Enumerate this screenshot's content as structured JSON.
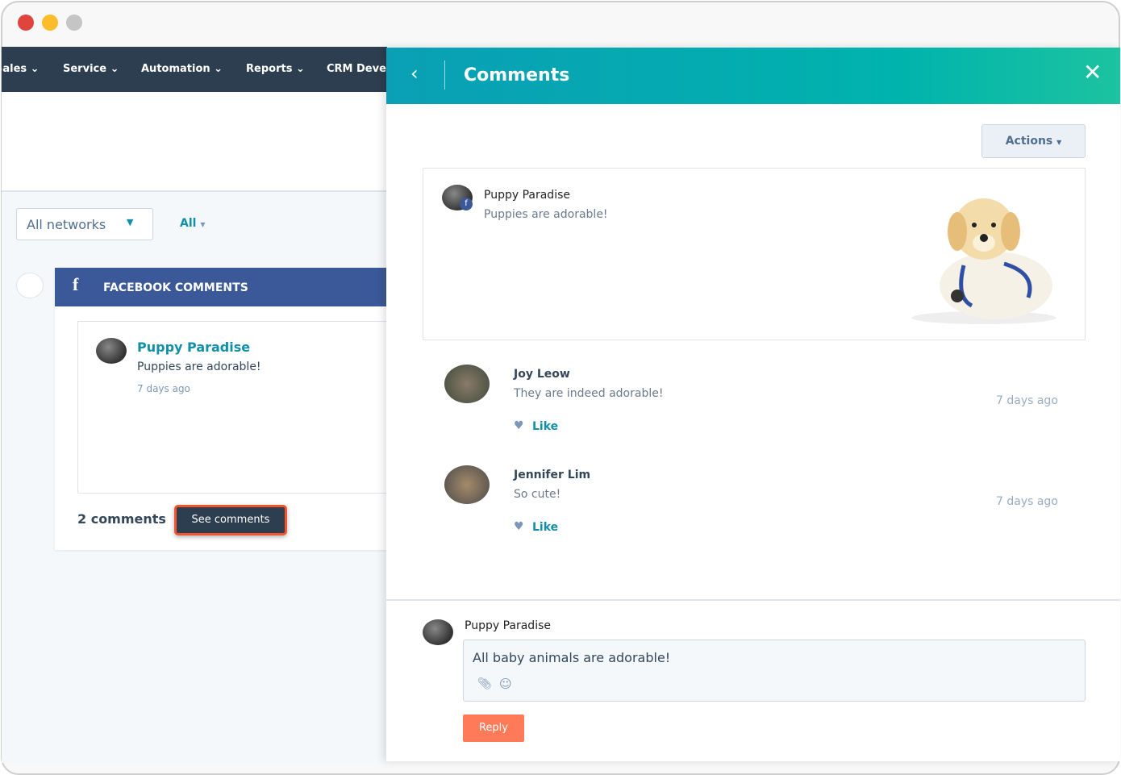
{
  "window": {
    "controls": [
      "close",
      "minimize",
      "maximize"
    ]
  },
  "nav": {
    "items": [
      {
        "label": "Sales"
      },
      {
        "label": "Service"
      },
      {
        "label": "Automation"
      },
      {
        "label": "Reports"
      },
      {
        "label": "CRM Deve"
      }
    ]
  },
  "filters": {
    "network": "All networks",
    "type": "All"
  },
  "feed": {
    "header": "FACEBOOK COMMENTS",
    "post": {
      "author": "Puppy Paradise",
      "text": "Puppies are adorable!",
      "time": "7 days ago"
    },
    "comment_count": "2 comments",
    "see_comments": "See comments"
  },
  "panel": {
    "title": "Comments",
    "actions": "Actions",
    "post": {
      "author": "Puppy Paradise",
      "text": "Puppies are adorable!"
    },
    "comments": [
      {
        "author": "Joy Leow",
        "text": "They are indeed adorable!",
        "time": "7 days ago",
        "like": "Like"
      },
      {
        "author": "Jennifer Lim",
        "text": "So cute!",
        "time": "7 days ago",
        "like": "Like"
      }
    ],
    "reply": {
      "author": "Puppy Paradise",
      "value": "All baby animals are adorable!",
      "button": "Reply"
    }
  },
  "colors": {
    "nav": "#2d3e50",
    "facebook": "#3b5998",
    "teal": "#00a4b4",
    "reply": "#ff7a59",
    "highlight": "#f2542d"
  }
}
